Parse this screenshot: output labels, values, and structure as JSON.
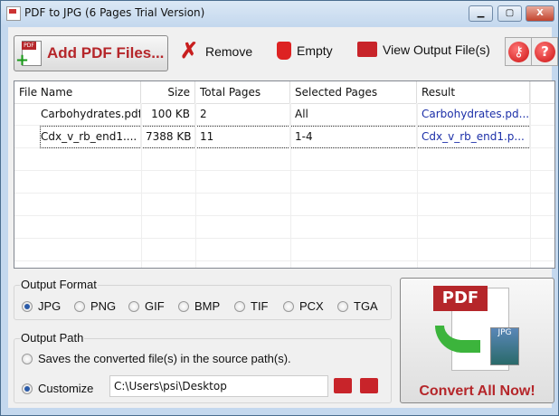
{
  "window": {
    "title": "PDF to JPG (6 Pages Trial Version)",
    "minimize": "▁",
    "maximize": "▢",
    "close": "X"
  },
  "toolbar": {
    "add": "Add PDF Files...",
    "remove": "Remove",
    "empty": "Empty",
    "view_output": "View Output File(s)",
    "key": "⚷",
    "help": "?"
  },
  "table": {
    "headers": [
      "File Name",
      "Size",
      "Total Pages",
      "Selected Pages",
      "Result"
    ],
    "rows": [
      {
        "name": "Carbohydrates.pdf",
        "size": "100 KB",
        "total": "2",
        "selected": "All",
        "result": "Carbohydrates.pd..."
      },
      {
        "name": "Cdx_v_rb_end1....",
        "size": "7388 KB",
        "total": "11",
        "selected": "1-4",
        "result": "Cdx_v_rb_end1.p..."
      }
    ]
  },
  "output_format": {
    "label": "Output Format",
    "options": [
      "JPG",
      "PNG",
      "GIF",
      "BMP",
      "TIF",
      "PCX",
      "TGA"
    ],
    "selected": "JPG"
  },
  "output_path": {
    "label": "Output Path",
    "source_option": "Saves the converted file(s) in the source path(s).",
    "customize_option": "Customize",
    "path": "C:\\Users\\psi\\Desktop",
    "selected": "customize"
  },
  "convert": {
    "label": "Convert All Now!",
    "pdf_badge": "PDF",
    "jpg_badge": "JPG"
  }
}
